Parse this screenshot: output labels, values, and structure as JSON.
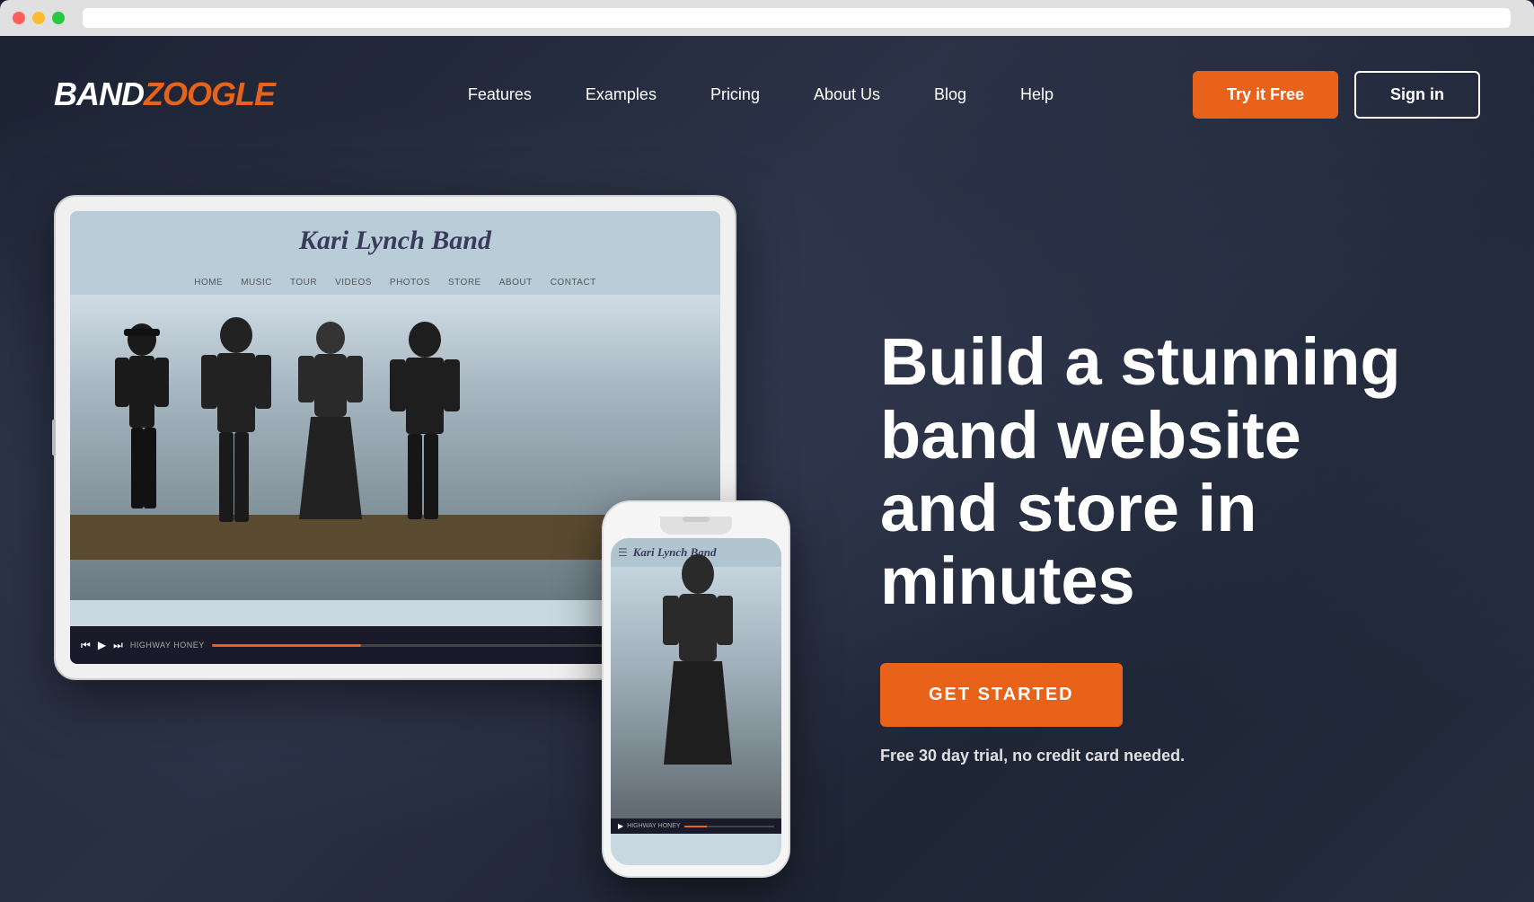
{
  "window": {
    "mac_buttons": [
      "red",
      "yellow",
      "green"
    ]
  },
  "navbar": {
    "logo_band": "BAND",
    "logo_zoogle": "ZOOGLE",
    "nav_links": [
      {
        "label": "Features",
        "id": "features"
      },
      {
        "label": "Examples",
        "id": "examples"
      },
      {
        "label": "Pricing",
        "id": "pricing"
      },
      {
        "label": "About Us",
        "id": "about"
      },
      {
        "label": "Blog",
        "id": "blog"
      },
      {
        "label": "Help",
        "id": "help"
      }
    ],
    "try_free_label": "Try it Free",
    "sign_in_label": "Sign in"
  },
  "hero": {
    "headline_line1": "Build a stunning",
    "headline_line2": "band website",
    "headline_line3": "and store in",
    "headline_line4": "minutes",
    "cta_label": "GET STARTED",
    "subtext": "Free 30 day trial, no credit card needed."
  },
  "tablet_mockup": {
    "site_title": "Kari Lynch Band",
    "nav_items": [
      "HOME",
      "MUSIC",
      "TOUR",
      "VIDEOS",
      "PHOTOS",
      "STORE",
      "ABOUT",
      "CONTACT"
    ],
    "player_song": "HIGHWAY HONEY"
  },
  "phone_mockup": {
    "site_title": "Kari Lynch Band",
    "player_song": "HIGHWAY HONEY"
  },
  "colors": {
    "orange": "#e8621a",
    "dark_bg": "#1e2535",
    "white": "#ffffff"
  }
}
